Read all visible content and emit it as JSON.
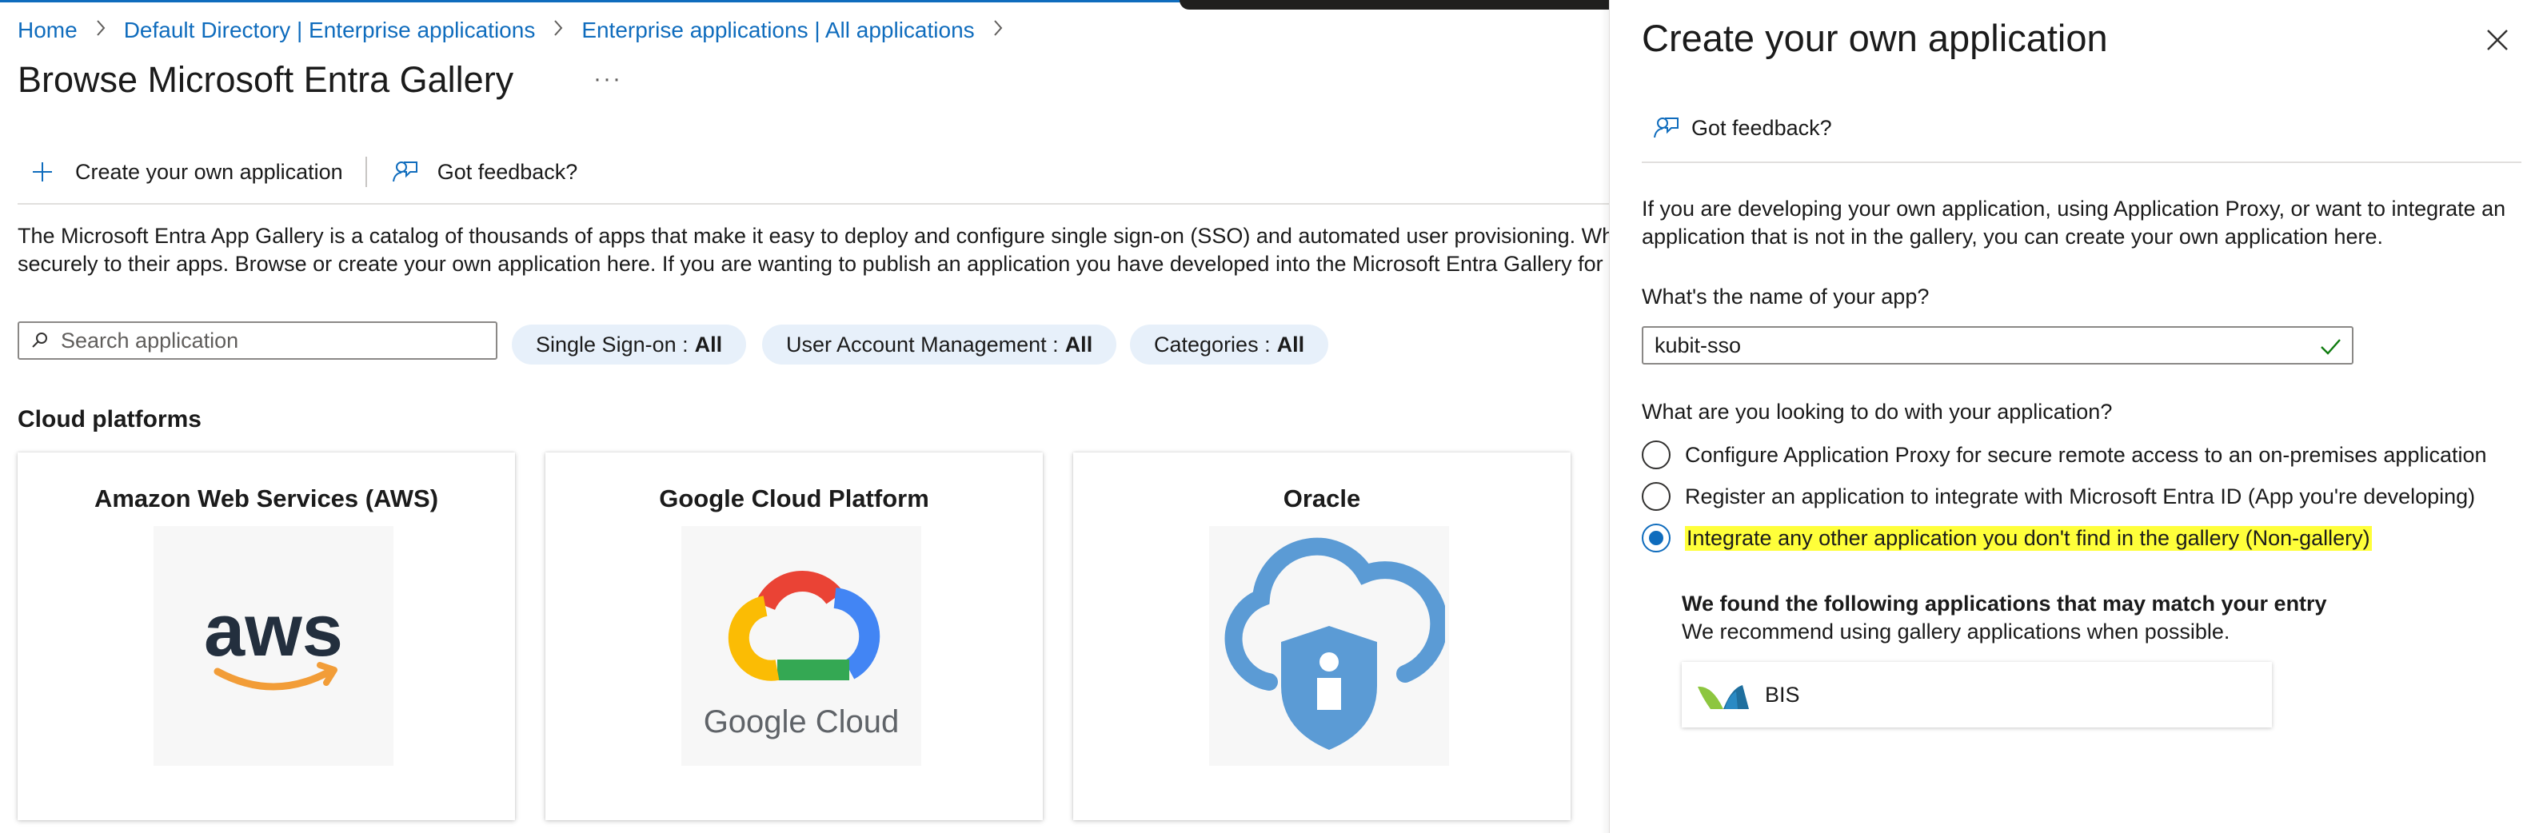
{
  "breadcrumb": {
    "items": [
      "Home",
      "Default Directory | Enterprise applications",
      "Enterprise applications | All applications"
    ]
  },
  "page": {
    "title": "Browse Microsoft Entra Gallery",
    "more": "···"
  },
  "commandbar": {
    "create_label": "Create your own application",
    "feedback_label": "Got feedback?"
  },
  "description": {
    "line1": "The Microsoft Entra App Gallery is a catalog of thousands of apps that make it easy to deploy and configure single sign-on (SSO) and automated user provisioning. When dep",
    "line2": "securely to their apps. Browse or create your own application here. If you are wanting to publish an application you have developed into the Microsoft Entra Gallery for other o"
  },
  "search": {
    "placeholder": "Search application"
  },
  "filters": [
    {
      "label": "Single Sign-on : ",
      "value": "All"
    },
    {
      "label": "User Account Management : ",
      "value": "All"
    },
    {
      "label": "Categories : ",
      "value": "All"
    }
  ],
  "section": {
    "title": "Cloud platforms"
  },
  "cards": [
    {
      "title": "Amazon Web Services (AWS)",
      "logo": "aws"
    },
    {
      "title": "Google Cloud Platform",
      "logo": "Google Cloud"
    },
    {
      "title": "Oracle",
      "logo": "oracle-cloud-shield"
    }
  ],
  "panel": {
    "title": "Create your own application",
    "feedback_label": "Got feedback?",
    "description": "If you are developing your own application, using Application Proxy, or want to integrate an application that is not in the gallery, you can create your own application here.",
    "name_label": "What's the name of your app?",
    "name_value": "kubit-sso",
    "purpose_label": "What are you looking to do with your application?",
    "options": [
      {
        "label": "Configure Application Proxy for secure remote access to an on-premises application",
        "checked": false
      },
      {
        "label": "Register an application to integrate with Microsoft Entra ID (App you're developing)",
        "checked": false
      },
      {
        "label": "Integrate any other application you don't find in the gallery (Non-gallery)",
        "checked": true
      }
    ],
    "match_title": "We found the following applications that may match your entry",
    "match_subtitle": "We recommend using gallery applications when possible.",
    "match_app": "BIS"
  },
  "colors": {
    "accent": "#0f6cbd",
    "highlight": "#ffff3a",
    "filter_bg": "#e7f0fa"
  }
}
